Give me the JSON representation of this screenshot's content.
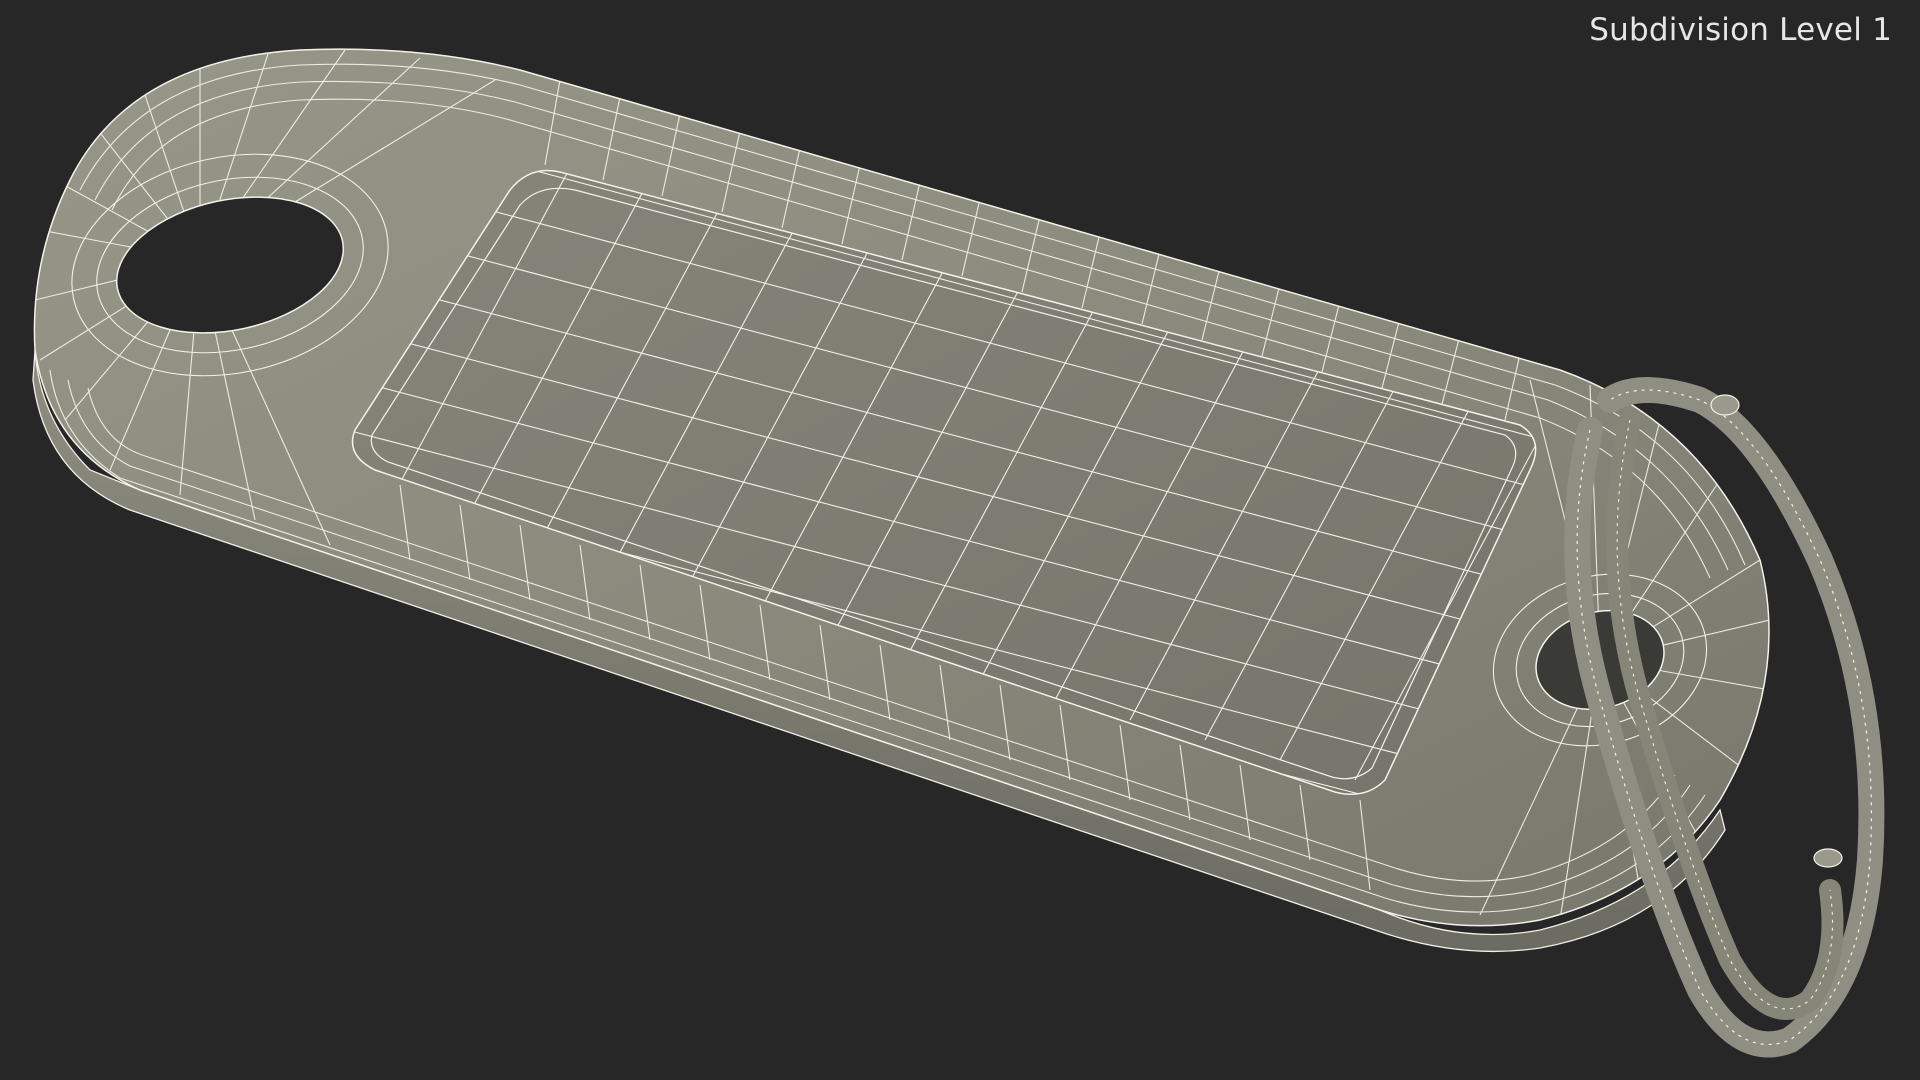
{
  "viewport": {
    "subdivision_label": "Subdivision Level 1"
  },
  "colors": {
    "background": "#272727",
    "surface": "#8f8f82",
    "surface_dark": "#74746a",
    "wire": "#f2f2ea"
  }
}
